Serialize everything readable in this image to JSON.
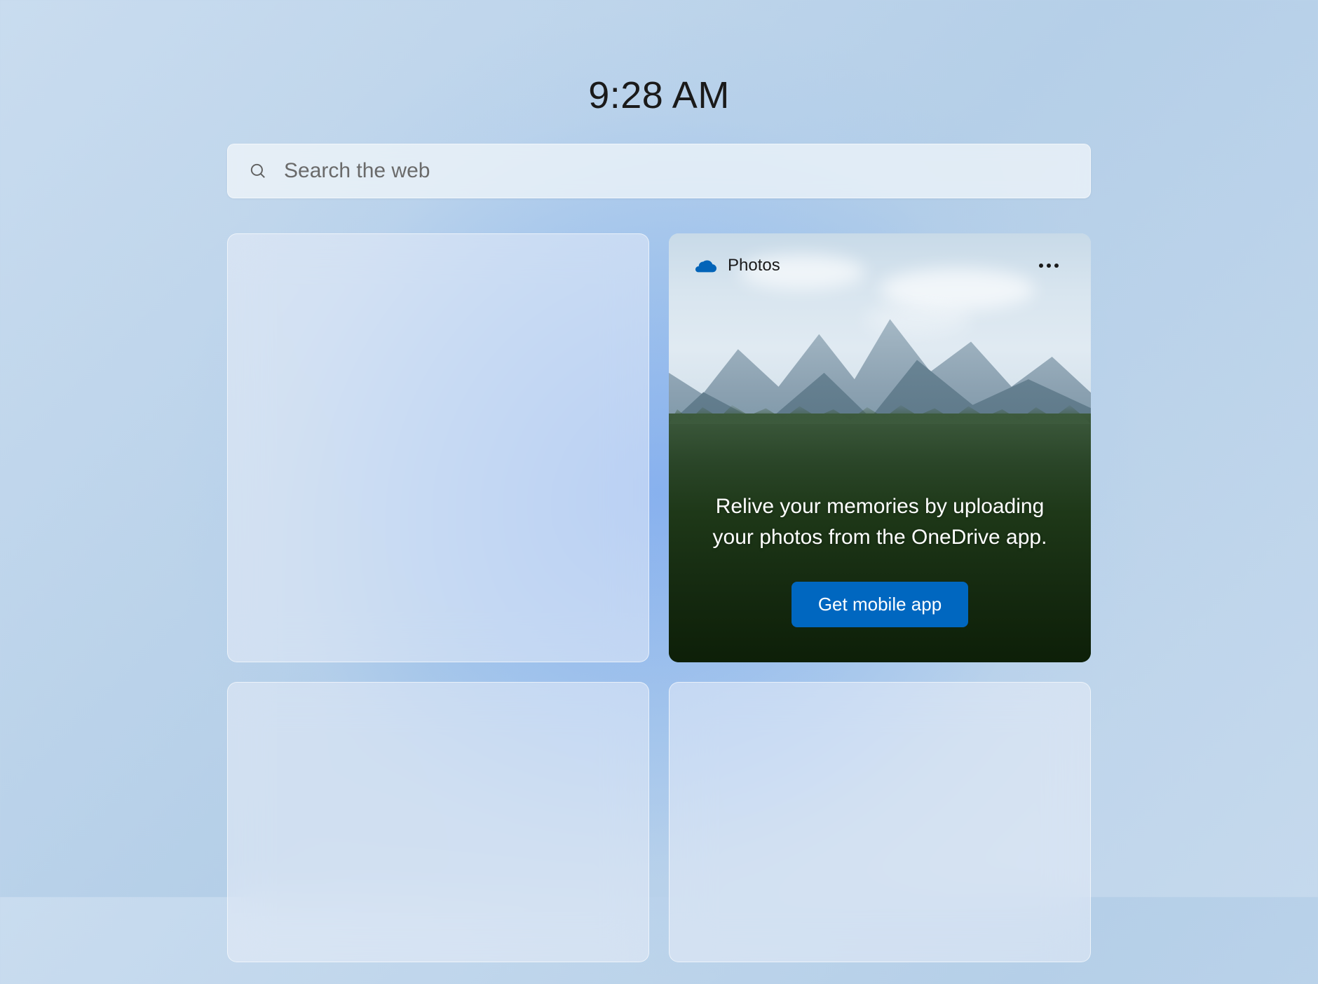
{
  "clock": {
    "time": "9:28 AM"
  },
  "search": {
    "placeholder": "Search the web"
  },
  "widgets": {
    "photos": {
      "icon_name": "onedrive-icon",
      "title": "Photos",
      "message": "Relive your memories by uploading your photos from the OneDrive app.",
      "cta_label": "Get mobile app"
    }
  },
  "colors": {
    "accent": "#0067c0"
  }
}
